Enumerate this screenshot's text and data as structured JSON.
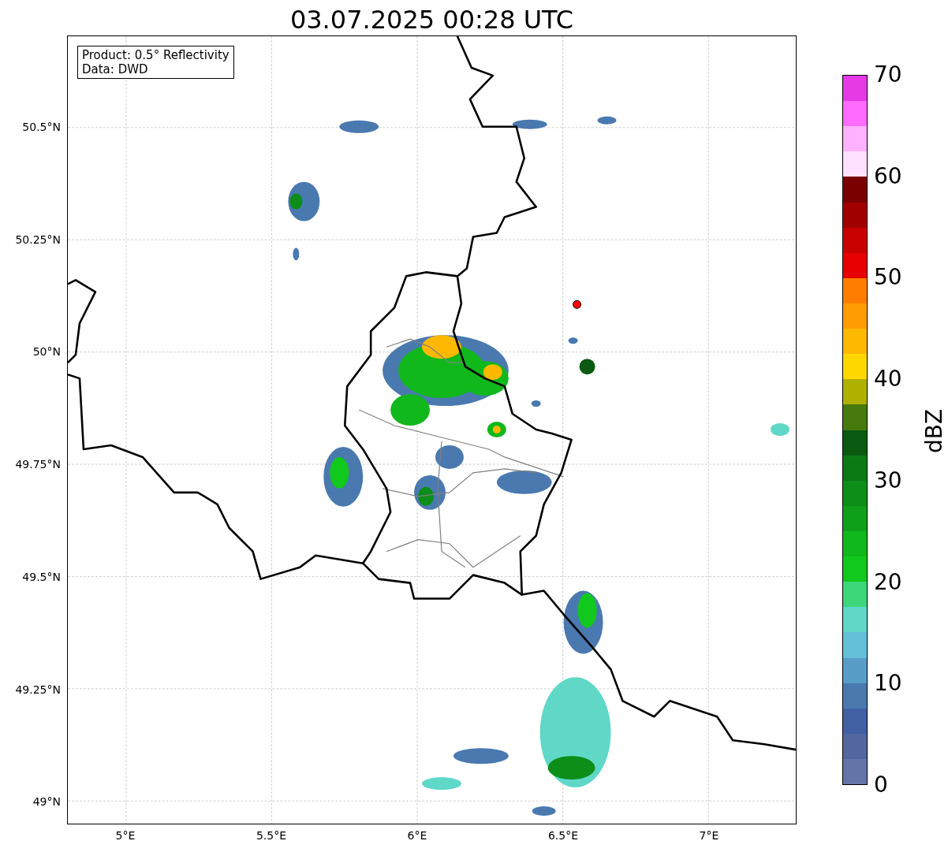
{
  "title": "03.07.2025 00:28 UTC",
  "info_box": [
    "Product: 0.5° Reflectivity",
    "Data: DWD"
  ],
  "map": {
    "yticks": [
      "50.5°N",
      "50.25°N",
      "50°N",
      "49.75°N",
      "49.5°N",
      "49.25°N",
      "49°N"
    ],
    "xticks": [
      "5°E",
      "5.5°E",
      "6°E",
      "6.5°E",
      "7°E"
    ]
  },
  "colorbar": {
    "label": "dBZ",
    "ticks": [
      "70",
      "60",
      "50",
      "40",
      "30",
      "20",
      "10",
      "0"
    ],
    "segments": [
      {
        "color": "#6474a8"
      },
      {
        "color": "#5366a0"
      },
      {
        "color": "#4360a4"
      },
      {
        "color": "#4a79b0"
      },
      {
        "color": "#589dc8"
      },
      {
        "color": "#63c0d8"
      },
      {
        "color": "#5fd8c8"
      },
      {
        "color": "#3dd77a"
      },
      {
        "color": "#10c91c"
      },
      {
        "color": "#10b81c"
      },
      {
        "color": "#0fa01a"
      },
      {
        "color": "#0d8e19"
      },
      {
        "color": "#0b7a16"
      },
      {
        "color": "#0a5a12"
      },
      {
        "color": "#467a0c"
      },
      {
        "color": "#b0b000"
      },
      {
        "color": "#ffd700"
      },
      {
        "color": "#ffb800"
      },
      {
        "color": "#ff9c00"
      },
      {
        "color": "#ff7d00"
      },
      {
        "color": "#e60000"
      },
      {
        "color": "#c80000"
      },
      {
        "color": "#a00000"
      },
      {
        "color": "#7a0000"
      },
      {
        "color": "#ffe0ff"
      },
      {
        "color": "#ffb2ff"
      },
      {
        "color": "#ff6bff"
      },
      {
        "color": "#e63ae6"
      }
    ]
  }
}
